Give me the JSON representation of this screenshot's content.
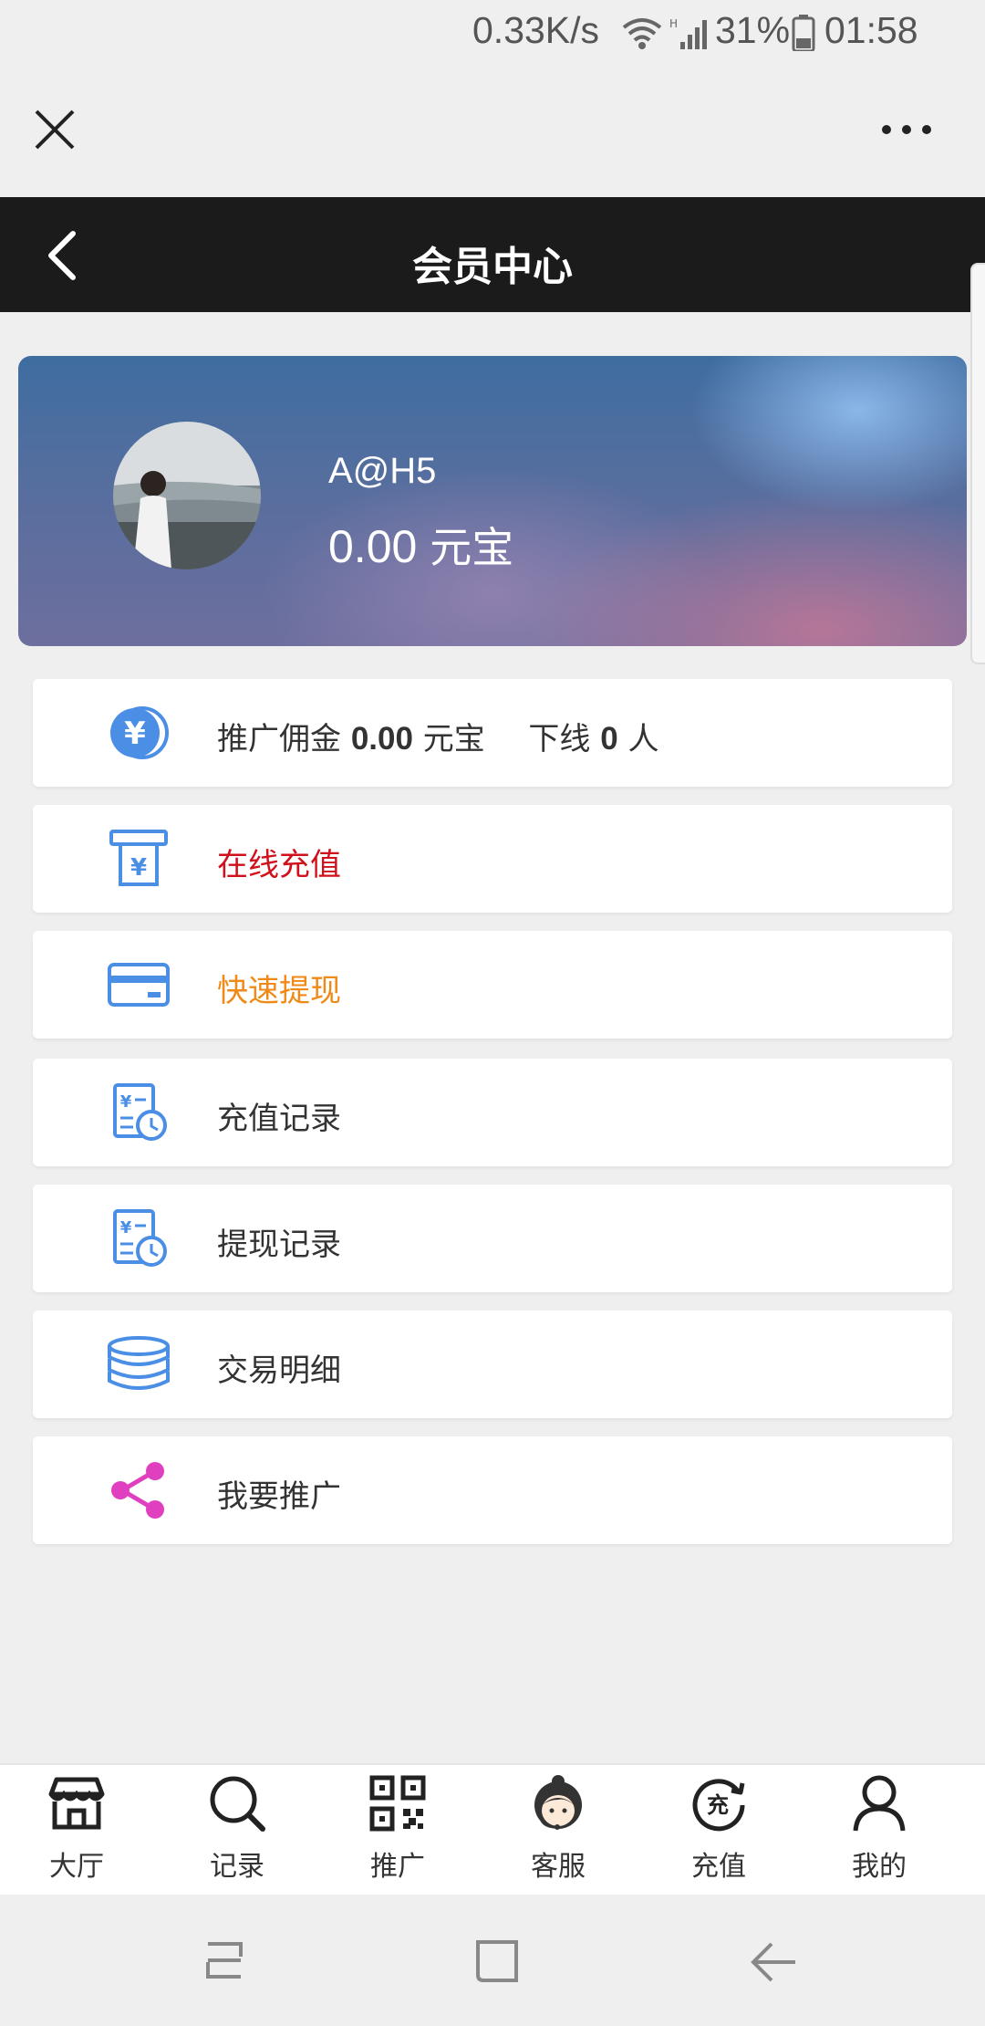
{
  "status_bar": {
    "net_speed": "0.33K/s",
    "battery": "31%",
    "time": "01:58",
    "icons": [
      "wifi-icon",
      "signal-icon",
      "battery-icon"
    ]
  },
  "top_bar": {
    "close_icon": "close-icon",
    "more_icon": "more-icon"
  },
  "header": {
    "back_icon": "back-arrow-icon",
    "title": "会员中心"
  },
  "profile": {
    "username": "A@H5",
    "balance_value": "0.00",
    "balance_unit": "元宝"
  },
  "menu": {
    "commission": {
      "prefix": "推广佣金",
      "value": "0.00",
      "unit": "元宝",
      "downline_prefix": "下线",
      "downline_count": "0",
      "downline_unit": "人",
      "icon": "coin-icon"
    },
    "recharge_online": {
      "label": "在线充值",
      "icon": "atm-icon",
      "color": "#d0101a"
    },
    "quick_withdraw": {
      "label": "快速提现",
      "icon": "card-icon",
      "color": "#ef8a17"
    },
    "recharge_record": {
      "label": "充值记录",
      "icon": "record-icon"
    },
    "withdraw_record": {
      "label": "提现记录",
      "icon": "record-icon"
    },
    "transactions": {
      "label": "交易明细",
      "icon": "coins-stack-icon"
    },
    "promote": {
      "label": "我要推广",
      "icon": "share-icon"
    }
  },
  "bottom_nav": {
    "items": [
      {
        "label": "大厅",
        "icon": "store-icon"
      },
      {
        "label": "记录",
        "icon": "search-icon"
      },
      {
        "label": "推广",
        "icon": "qrcode-icon"
      },
      {
        "label": "客服",
        "icon": "customer-service-icon"
      },
      {
        "label": "充值",
        "icon": "recharge-icon",
        "icon_text": "充"
      },
      {
        "label": "我的",
        "icon": "user-icon"
      }
    ]
  },
  "colors": {
    "header_bg": "#1b1b1b",
    "accent_blue": "#4a8ee6",
    "red": "#d0101a",
    "orange": "#ef8a17",
    "pink": "#e040c0"
  }
}
